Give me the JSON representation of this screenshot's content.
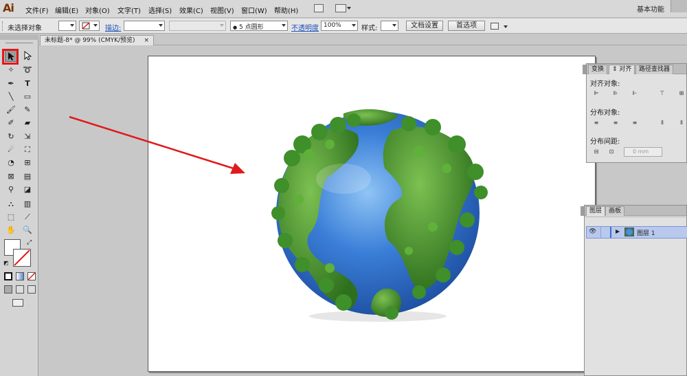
{
  "app": {
    "logo": "Ai",
    "menu": [
      "文件(F)",
      "编辑(E)",
      "对象(O)",
      "文字(T)",
      "选择(S)",
      "效果(C)",
      "视图(V)",
      "窗口(W)",
      "帮助(H)"
    ],
    "workspace": "基本功能"
  },
  "control_bar": {
    "selection_status": "未选择对象",
    "stroke_label": "描边:",
    "brush_value": "5 点圆形",
    "opacity_label": "不透明度",
    "opacity_value": "100%",
    "style_label": "样式:",
    "doc_setup_button": "文档设置",
    "preferences_button": "首选项"
  },
  "document": {
    "tab_title": "未标题-8* @ 99% (CMYK/预览)",
    "close_glyph": "×"
  },
  "align_panel": {
    "tabs": [
      "变换",
      "对齐",
      "路径查找器"
    ],
    "active_tab": "对齐",
    "align_objects_label": "对齐对象:",
    "distribute_objects_label": "分布对象:",
    "distribute_spacing_label": "分布间距:",
    "spacing_value": "0 mm"
  },
  "layers_panel": {
    "tabs": [
      "图层",
      "画板"
    ],
    "layer_name": "图层 1"
  },
  "colors": {
    "highlight": "#e0191a",
    "arrow": "#e0191a",
    "link": "#1d4fb8",
    "ocean": "#2f6ec9",
    "land": "#3f8f2a"
  },
  "icons": {
    "selection_tool": "selection-arrow-icon",
    "direct_selection_tool": "direct-selection-icon",
    "visibility": "eye-icon"
  }
}
